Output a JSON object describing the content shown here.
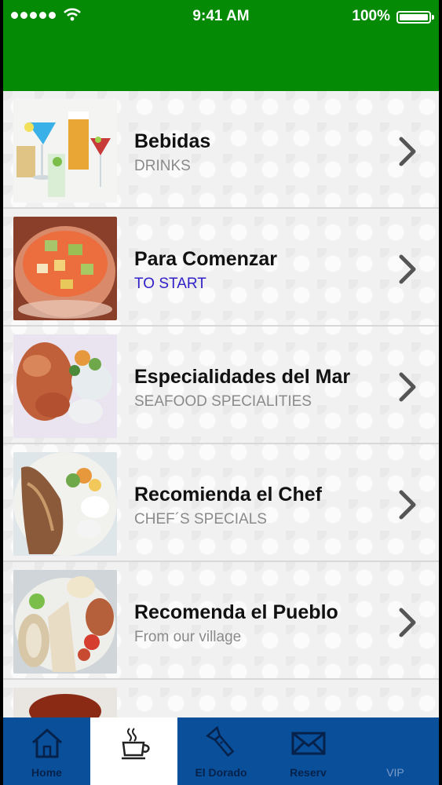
{
  "status_bar": {
    "time": "9:41 AM",
    "battery": "100%",
    "signal_dots": 5,
    "icons": [
      "signal-icon",
      "wifi-icon",
      "battery-icon"
    ]
  },
  "menu": [
    {
      "title": "Bebidas",
      "subtitle": "DRINKS",
      "image": "drinks-photo"
    },
    {
      "title": "Para Comenzar",
      "subtitle": "TO START",
      "image": "ceviche-photo"
    },
    {
      "title": "Especialidades del Mar",
      "subtitle": "SEAFOOD SPECIALITIES",
      "image": "seafood-photo"
    },
    {
      "title": "Recomienda el Chef",
      "subtitle": "CHEF´S SPECIALS",
      "image": "fish-plate-photo"
    },
    {
      "title": "Recomenda el Pueblo",
      "subtitle": "From our village",
      "image": "village-plate-photo"
    }
  ],
  "tabs": [
    {
      "label": "Home",
      "icon": "home-icon"
    },
    {
      "label": "",
      "icon": "coffee-cup-icon",
      "active": true
    },
    {
      "label": "El Dorado",
      "icon": "flashlight-icon"
    },
    {
      "label": "Reserv",
      "icon": "envelope-icon"
    },
    {
      "label": "VIP",
      "icon": ""
    }
  ],
  "colors": {
    "header": "#058a05",
    "tabbar": "#0a4f9a",
    "subtitle_accent": "#3020c8"
  }
}
